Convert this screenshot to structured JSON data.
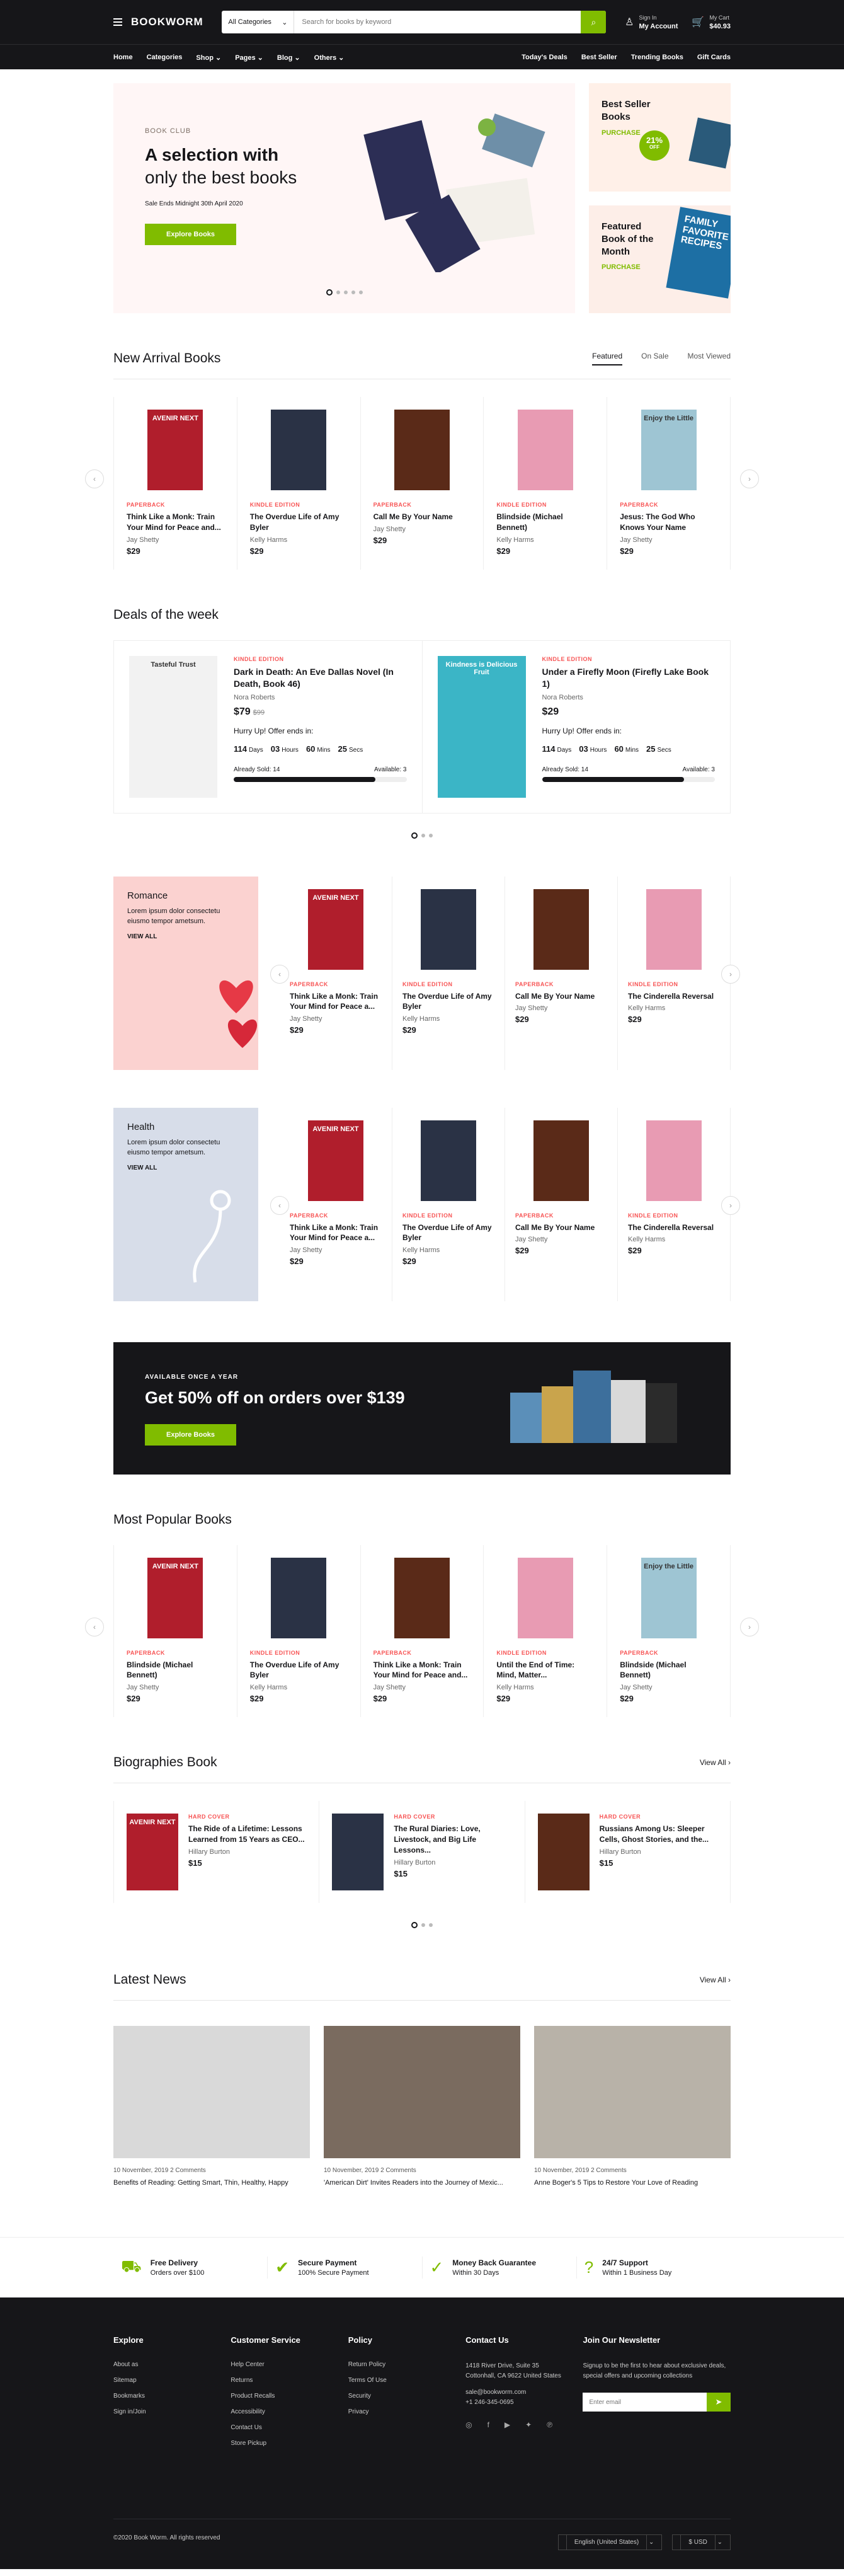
{
  "header": {
    "logo": "BOOKWORM",
    "search_category": "All Categories",
    "search_placeholder": "Search for books by keyword",
    "signin_small": "Sign In",
    "signin": "My Account",
    "cart_small": "My Cart",
    "cart": "$40.93"
  },
  "nav": {
    "left": [
      "Home",
      "Categories",
      "Shop",
      "Pages",
      "Blog",
      "Others"
    ],
    "right": [
      "Today's Deals",
      "Best Seller",
      "Trending Books",
      "Gift Cards"
    ]
  },
  "hero": {
    "tag": "BOOK CLUB",
    "h1": "A selection with",
    "h2": "only the best books",
    "ends": "Sale Ends Midnight 30th April 2020",
    "btn": "Explore Books"
  },
  "promo1": {
    "title": "Best Seller Books",
    "sub": "PURCHASE",
    "pct": "21%",
    "off": "OFF"
  },
  "promo2": {
    "title": "Featured Book of the Month",
    "sub": "PURCHASE",
    "book": "FAMILY FAVORITE RECIPES"
  },
  "new_arrivals": {
    "title": "New Arrival Books",
    "tabs": [
      "Featured",
      "On Sale",
      "Most Viewed"
    ],
    "books": [
      {
        "kind": "PAPERBACK",
        "title": "Think Like a Monk: Train Your Mind for Peace and...",
        "author": "Jay Shetty",
        "price": "$29",
        "cover": "AVENIR NEXT",
        "color": "#b01e2c"
      },
      {
        "kind": "KINDLE EDITION",
        "title": "The Overdue Life of Amy Byler",
        "author": "Kelly Harms",
        "price": "$29",
        "cover": "",
        "color": "#2a3245"
      },
      {
        "kind": "PAPERBACK",
        "title": "Call Me By Your Name",
        "author": "Jay Shetty",
        "price": "$29",
        "cover": "",
        "color": "#5a2a18"
      },
      {
        "kind": "KINDLE EDITION",
        "title": "Blindside (Michael Bennett)",
        "author": "Kelly Harms",
        "price": "$29",
        "cover": "",
        "color": "#e89bb3"
      },
      {
        "kind": "PAPERBACK",
        "title": "Jesus: The God Who Knows Your Name",
        "author": "Jay Shetty",
        "price": "$29",
        "cover": "Enjoy the Little",
        "color": "#9ec5d3"
      }
    ]
  },
  "deals": {
    "title": "Deals of the week",
    "items": [
      {
        "kind": "KINDLE EDITION",
        "title": "Dark in Death: An Eve Dallas Novel (In Death, Book 46)",
        "author": "Nora Roberts",
        "price": "$79",
        "old": "$99",
        "hurry": "Hurry Up! Offer ends in:",
        "cd": [
          [
            "114",
            "Days"
          ],
          [
            "03",
            "Hours"
          ],
          [
            "60",
            "Mins"
          ],
          [
            "25",
            "Secs"
          ]
        ],
        "sold": "Already Sold: 14",
        "avail": "Available: 3",
        "pct": 82,
        "cover": "Tasteful Trust",
        "color": "#f2f2f2"
      },
      {
        "kind": "KINDLE EDITION",
        "title": "Under a Firefly Moon (Firefly Lake Book 1)",
        "author": "Nora Roberts",
        "price": "$29",
        "old": "",
        "hurry": "Hurry Up! Offer ends in:",
        "cd": [
          [
            "114",
            "Days"
          ],
          [
            "03",
            "Hours"
          ],
          [
            "60",
            "Mins"
          ],
          [
            "25",
            "Secs"
          ]
        ],
        "sold": "Already Sold: 14",
        "avail": "Available: 3",
        "pct": 82,
        "cover": "Kindness is Delicious Fruit",
        "color": "#3bb5c6"
      }
    ]
  },
  "romance": {
    "title": "Romance",
    "desc": "Lorem ipsum dolor consectetu eiusmo tempor ametsum.",
    "va": "VIEW ALL",
    "books": [
      {
        "kind": "PAPERBACK",
        "title": "Think Like a Monk: Train Your Mind for Peace a...",
        "author": "Jay Shetty",
        "price": "$29",
        "cover": "AVENIR NEXT",
        "color": "#b01e2c"
      },
      {
        "kind": "KINDLE EDITION",
        "title": "The Overdue Life of Amy Byler",
        "author": "Kelly Harms",
        "price": "$29",
        "cover": "",
        "color": "#2a3245"
      },
      {
        "kind": "PAPERBACK",
        "title": "Call Me By Your Name",
        "author": "Jay Shetty",
        "price": "$29",
        "cover": "",
        "color": "#5a2a18"
      },
      {
        "kind": "KINDLE EDITION",
        "title": "The Cinderella Reversal",
        "author": "Kelly Harms",
        "price": "$29",
        "cover": "",
        "color": "#e89bb3"
      }
    ]
  },
  "health": {
    "title": "Health",
    "desc": "Lorem ipsum dolor consectetu eiusmo tempor ametsum.",
    "va": "VIEW ALL",
    "books": [
      {
        "kind": "PAPERBACK",
        "title": "Think Like a Monk: Train Your Mind for Peace a...",
        "author": "Jay Shetty",
        "price": "$29",
        "cover": "AVENIR NEXT",
        "color": "#b01e2c"
      },
      {
        "kind": "KINDLE EDITION",
        "title": "The Overdue Life of Amy Byler",
        "author": "Kelly Harms",
        "price": "$29",
        "cover": "",
        "color": "#2a3245"
      },
      {
        "kind": "PAPERBACK",
        "title": "Call Me By Your Name",
        "author": "Jay Shetty",
        "price": "$29",
        "cover": "",
        "color": "#5a2a18"
      },
      {
        "kind": "KINDLE EDITION",
        "title": "The Cinderella Reversal",
        "author": "Kelly Harms",
        "price": "$29",
        "cover": "",
        "color": "#e89bb3"
      }
    ]
  },
  "banner": {
    "tag": "AVAILABLE ONCE A YEAR",
    "title": "Get 50% off on orders over $139",
    "btn": "Explore Books"
  },
  "popular": {
    "title": "Most Popular Books",
    "books": [
      {
        "kind": "PAPERBACK",
        "title": "Blindside (Michael Bennett)",
        "author": "Jay Shetty",
        "price": "$29",
        "cover": "AVENIR NEXT",
        "color": "#b01e2c"
      },
      {
        "kind": "KINDLE EDITION",
        "title": "The Overdue Life of Amy Byler",
        "author": "Kelly Harms",
        "price": "$29",
        "cover": "",
        "color": "#2a3245"
      },
      {
        "kind": "PAPERBACK",
        "title": "Think Like a Monk: Train Your Mind for Peace and...",
        "author": "Jay Shetty",
        "price": "$29",
        "cover": "",
        "color": "#5a2a18"
      },
      {
        "kind": "KINDLE EDITION",
        "title": "Until the End of Time: Mind, Matter...",
        "author": "Kelly Harms",
        "price": "$29",
        "cover": "",
        "color": "#e89bb3"
      },
      {
        "kind": "PAPERBACK",
        "title": "Blindside (Michael Bennett)",
        "author": "Jay Shetty",
        "price": "$29",
        "cover": "Enjoy the Little",
        "color": "#9ec5d3"
      }
    ]
  },
  "bio": {
    "title": "Biographies Book",
    "viewall": "View All",
    "books": [
      {
        "kind": "HARD COVER",
        "title": "The Ride of a Lifetime: Lessons Learned from 15 Years as CEO...",
        "author": "Hillary Burton",
        "price": "$15",
        "cover": "AVENIR NEXT",
        "color": "#b01e2c"
      },
      {
        "kind": "HARD COVER",
        "title": "The Rural Diaries: Love, Livestock, and Big Life Lessons...",
        "author": "Hillary Burton",
        "price": "$15",
        "cover": "",
        "color": "#2a3245"
      },
      {
        "kind": "HARD COVER",
        "title": "Russians Among Us: Sleeper Cells, Ghost Stories, and the...",
        "author": "Hillary Burton",
        "price": "$15",
        "cover": "",
        "color": "#5a2a18"
      }
    ]
  },
  "news": {
    "title": "Latest News",
    "viewall": "View All",
    "items": [
      {
        "date": "10 November, 2019",
        "comments": "2 Comments",
        "title": "Benefits of Reading: Getting Smart, Thin, Healthy, Happy",
        "color": "#d9d9d9"
      },
      {
        "date": "10 November, 2019",
        "comments": "2 Comments",
        "title": "'American Dirt' Invites Readers into the Journey of Mexic...",
        "color": "#7a6b5f"
      },
      {
        "date": "10 November, 2019",
        "comments": "2 Comments",
        "title": "Anne Boger's 5 Tips to Restore Your Love of Reading",
        "color": "#b8b2a8"
      }
    ]
  },
  "features": [
    {
      "title": "Free Delivery",
      "sub": "Orders over $100",
      "icon": "truck-icon",
      "glyph": "⛟"
    },
    {
      "title": "Secure Payment",
      "sub": "100% Secure Payment",
      "icon": "shield-icon",
      "glyph": "✔"
    },
    {
      "title": "Money Back Guarantee",
      "sub": "Within 30 Days",
      "icon": "check-circle-icon",
      "glyph": "✓"
    },
    {
      "title": "24/7 Support",
      "sub": "Within 1 Business Day",
      "icon": "support-icon",
      "glyph": "?"
    }
  ],
  "footer": {
    "explore": {
      "title": "Explore",
      "links": [
        "About as",
        "Sitemap",
        "Bookmarks",
        "Sign in/Join"
      ]
    },
    "service": {
      "title": "Customer Service",
      "links": [
        "Help Center",
        "Returns",
        "Product Recalls",
        "Accessibility",
        "Contact Us",
        "Store Pickup"
      ]
    },
    "policy": {
      "title": "Policy",
      "links": [
        "Return Policy",
        "Terms Of Use",
        "Security",
        "Privacy"
      ]
    },
    "contact": {
      "title": "Contact Us",
      "addr": "1418 River Drive, Suite 35 Cottonhall, CA 9622 United States",
      "email": "sale@bookworm.com",
      "phone": "+1 246-345-0695"
    },
    "newsletter": {
      "title": "Join Our Newsletter",
      "desc": "Signup to be the first to hear about exclusive deals, special offers and upcoming collections",
      "placeholder": "Enter email"
    },
    "copyright": "©2020 Book Worm. All rights reserved",
    "lang": "English (United States)",
    "currency": "$ USD"
  },
  "colors": {
    "accent": "#80bc00",
    "dark": "#161619",
    "sale": "#f75454"
  }
}
